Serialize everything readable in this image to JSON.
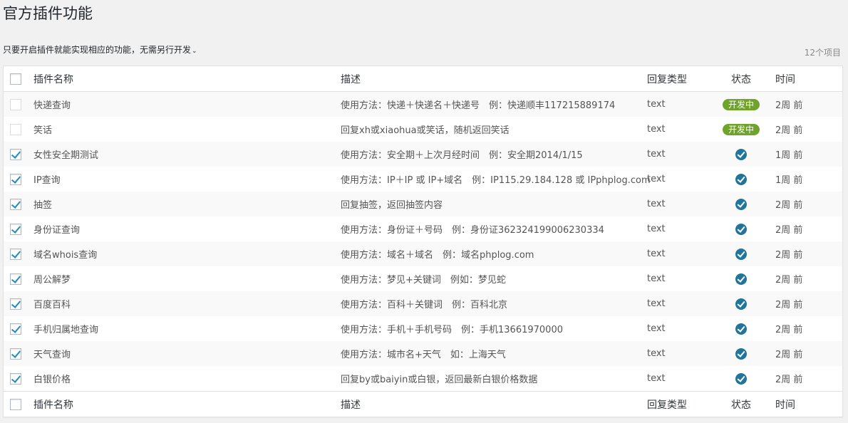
{
  "page": {
    "title": "官方插件功能",
    "subtitle": "只要开启插件就能实现相应的功能，无需另行开发",
    "caret": "⌄",
    "count": "12个项目"
  },
  "columns": {
    "name": "插件名称",
    "desc": "描述",
    "type": "回复类型",
    "status": "状态",
    "time": "时间"
  },
  "rows": [
    {
      "name": "快递查询",
      "desc": "使用方法：快递＋快递名＋快递号　例：快递顺丰117215889174",
      "type": "text",
      "status": "开发中",
      "time": "2周 前",
      "checked": false
    },
    {
      "name": "笑话",
      "desc": "回复xh或xiaohua或笑话，随机返回笑话",
      "type": "text",
      "status": "开发中",
      "time": "2周 前",
      "checked": false
    },
    {
      "name": "女性安全期测试",
      "desc": "使用方法：安全期＋上次月经时间　例：安全期2014/1/15",
      "type": "text",
      "status": "enabled",
      "time": "1周 前",
      "checked": true
    },
    {
      "name": "IP查询",
      "desc": "使用方法：IP＋IP 或 IP+域名　例：IP115.29.184.128 或 IPphplog.com",
      "type": "text",
      "status": "enabled",
      "time": "1周 前",
      "checked": true
    },
    {
      "name": "抽签",
      "desc": "回复抽签，返回抽签内容",
      "type": "text",
      "status": "enabled",
      "time": "2周 前",
      "checked": true
    },
    {
      "name": "身份证查询",
      "desc": "使用方法：身份证＋号码　例：身份证362324199006230334",
      "type": "text",
      "status": "enabled",
      "time": "2周 前",
      "checked": true
    },
    {
      "name": "域名whois查询",
      "desc": "使用方法：域名＋域名　例：域名phplog.com",
      "type": "text",
      "status": "enabled",
      "time": "2周 前",
      "checked": true
    },
    {
      "name": "周公解梦",
      "desc": "使用方法：梦见+关键词　例如：梦见蛇",
      "type": "text",
      "status": "enabled",
      "time": "2周 前",
      "checked": true
    },
    {
      "name": "百度百科",
      "desc": "使用方法：百科＋关键词　例：百科北京",
      "type": "text",
      "status": "enabled",
      "time": "2周 前",
      "checked": true
    },
    {
      "name": "手机归属地查询",
      "desc": "使用方法：手机＋手机号码　例：手机13661970000",
      "type": "text",
      "status": "enabled",
      "time": "2周 前",
      "checked": true
    },
    {
      "name": "天气查询",
      "desc": "使用方法：城市名+天气　如：上海天气",
      "type": "text",
      "status": "enabled",
      "time": "2周 前",
      "checked": true
    },
    {
      "name": "白银价格",
      "desc": "回复by或baiyin或白银，返回最新白银价格数据",
      "type": "text",
      "status": "enabled",
      "time": "2周 前",
      "checked": true
    }
  ],
  "colors": {
    "badge": "#6fa32a",
    "enabled_icon": "#21759b",
    "checkbox_tick": "#1e8cbe"
  }
}
